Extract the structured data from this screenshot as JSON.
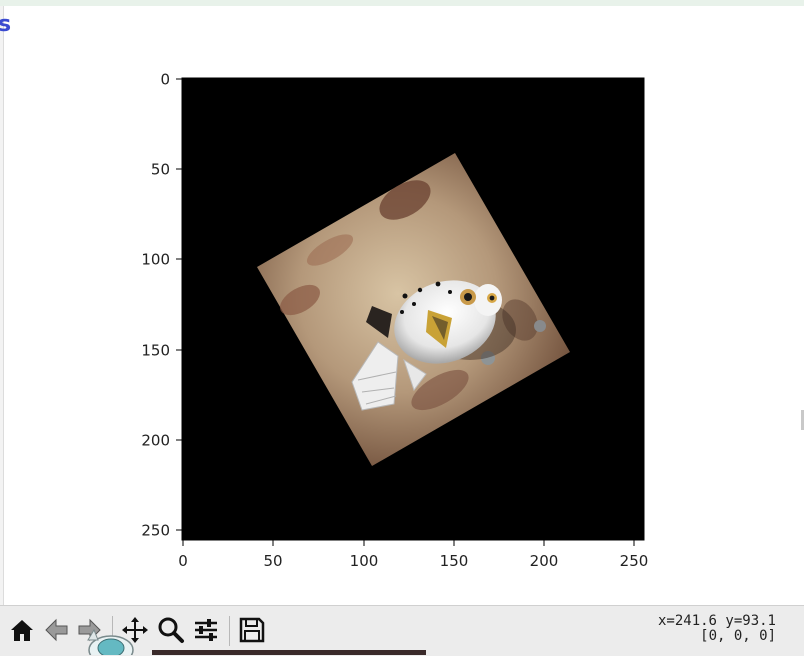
{
  "plot": {
    "image_description_alt": "",
    "y_ticks": [
      "0",
      "50",
      "100",
      "150",
      "200",
      "250"
    ],
    "x_ticks": [
      "0",
      "50",
      "100",
      "150",
      "200",
      "250"
    ]
  },
  "toolbar": {
    "icons": [
      "home-icon",
      "back-icon",
      "forward-icon",
      "pan-icon",
      "zoom-icon",
      "configure-icon",
      "save-icon"
    ]
  },
  "status": {
    "xy": "x=241.6 y=93.1",
    "value": "[0, 0, 0]"
  },
  "colors": {
    "toolbar_bg": "#ececec",
    "plot_bg": "#000000",
    "accent": "#3a4ad0"
  }
}
